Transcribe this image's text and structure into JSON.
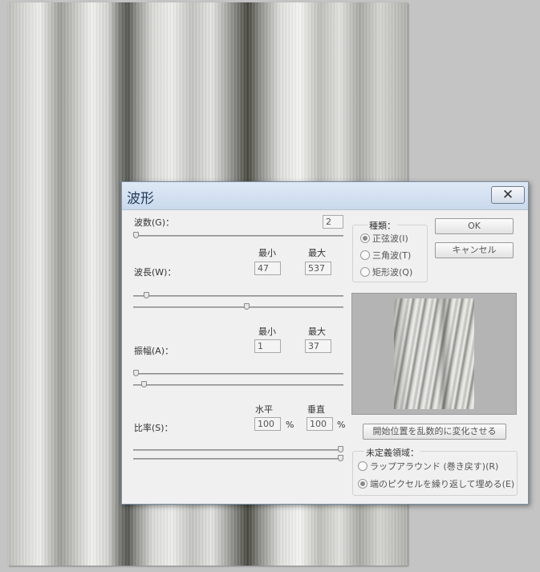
{
  "dialog": {
    "title": "波形",
    "close_glyph": "✕"
  },
  "generators": {
    "label": "波数(G)：",
    "value": "2",
    "slider_fraction": 0.0
  },
  "wavelength": {
    "label": "波長(W)：",
    "min_label": "最小",
    "max_label": "最大",
    "min": "47",
    "max": "537",
    "min_slider_fraction": 0.05,
    "max_slider_fraction": 0.54
  },
  "amplitude": {
    "label": "振幅(A)：",
    "min_label": "最小",
    "max_label": "最大",
    "min": "1",
    "max": "37",
    "min_slider_fraction": 0.0,
    "max_slider_fraction": 0.04
  },
  "scale": {
    "label": "比率(S)：",
    "horizontal_label": "水平",
    "vertical_label": "垂直",
    "horizontal": "100",
    "vertical": "100",
    "unit": "%",
    "horizontal_slider_fraction": 1.0,
    "vertical_slider_fraction": 1.0
  },
  "type": {
    "label": "種類：",
    "options": [
      {
        "label": "正弦波(I)",
        "selected": true
      },
      {
        "label": "三角波(T)",
        "selected": false
      },
      {
        "label": "矩形波(Q)",
        "selected": false
      }
    ]
  },
  "buttons": {
    "ok": "OK",
    "cancel": "キャンセル",
    "randomize": "開始位置を乱数的に変化させる"
  },
  "undefined_areas": {
    "label": "未定義領域：",
    "options": [
      {
        "label": "ラップアラウンド (巻き戻す)(R)",
        "selected": false
      },
      {
        "label": "端のピクセルを繰り返して埋める(E)",
        "selected": true
      }
    ]
  }
}
